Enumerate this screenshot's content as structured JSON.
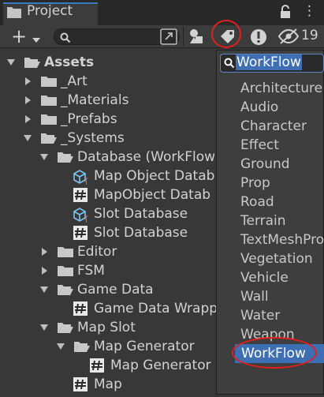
{
  "tab": {
    "title": "Project",
    "more": "⋮"
  },
  "toolbar": {
    "create_symbol": "+",
    "search_value": "",
    "hidden_count": "19"
  },
  "tree": [
    {
      "label": "Assets",
      "depth": 0,
      "expanded": true,
      "kind": "folder",
      "bold": true
    },
    {
      "label": "_Art",
      "depth": 1,
      "expanded": false,
      "kind": "folder"
    },
    {
      "label": "_Materials",
      "depth": 1,
      "expanded": false,
      "kind": "folder"
    },
    {
      "label": "_Prefabs",
      "depth": 1,
      "expanded": false,
      "kind": "folder"
    },
    {
      "label": "_Systems",
      "depth": 1,
      "expanded": true,
      "kind": "folder"
    },
    {
      "label": "Database (WorkFlow",
      "depth": 2,
      "expanded": true,
      "kind": "folder"
    },
    {
      "label": "Map Object Datab",
      "depth": 3,
      "kind": "scriptable"
    },
    {
      "label": "MapObject Datab",
      "depth": 3,
      "kind": "script"
    },
    {
      "label": "Slot Database",
      "depth": 3,
      "kind": "scriptable"
    },
    {
      "label": "Slot Database",
      "depth": 3,
      "kind": "script"
    },
    {
      "label": "Editor",
      "depth": 2,
      "expanded": false,
      "kind": "folder"
    },
    {
      "label": "FSM",
      "depth": 2,
      "expanded": false,
      "kind": "folder"
    },
    {
      "label": "Game Data",
      "depth": 2,
      "expanded": true,
      "kind": "folder"
    },
    {
      "label": "Game Data Wrapp",
      "depth": 3,
      "kind": "script"
    },
    {
      "label": "Map Slot",
      "depth": 2,
      "expanded": true,
      "kind": "folder"
    },
    {
      "label": "Map Generator",
      "depth": 3,
      "expanded": true,
      "kind": "folder"
    },
    {
      "label": "Map Generator",
      "depth": 4,
      "kind": "script"
    },
    {
      "label": "Map",
      "depth": 3,
      "kind": "script"
    }
  ],
  "label_dropdown": {
    "search_value": "WorkFlow",
    "items": [
      "Architecture",
      "Audio",
      "Character",
      "Effect",
      "Ground",
      "Prop",
      "Road",
      "Terrain",
      "TextMeshPro",
      "Vegetation",
      "Vehicle",
      "Wall",
      "Water",
      "Weapon"
    ],
    "selected": "WorkFlow"
  },
  "colors": {
    "accent": "#3e6fb3",
    "annotation": "#e0201e",
    "panel_bg": "#383838"
  }
}
